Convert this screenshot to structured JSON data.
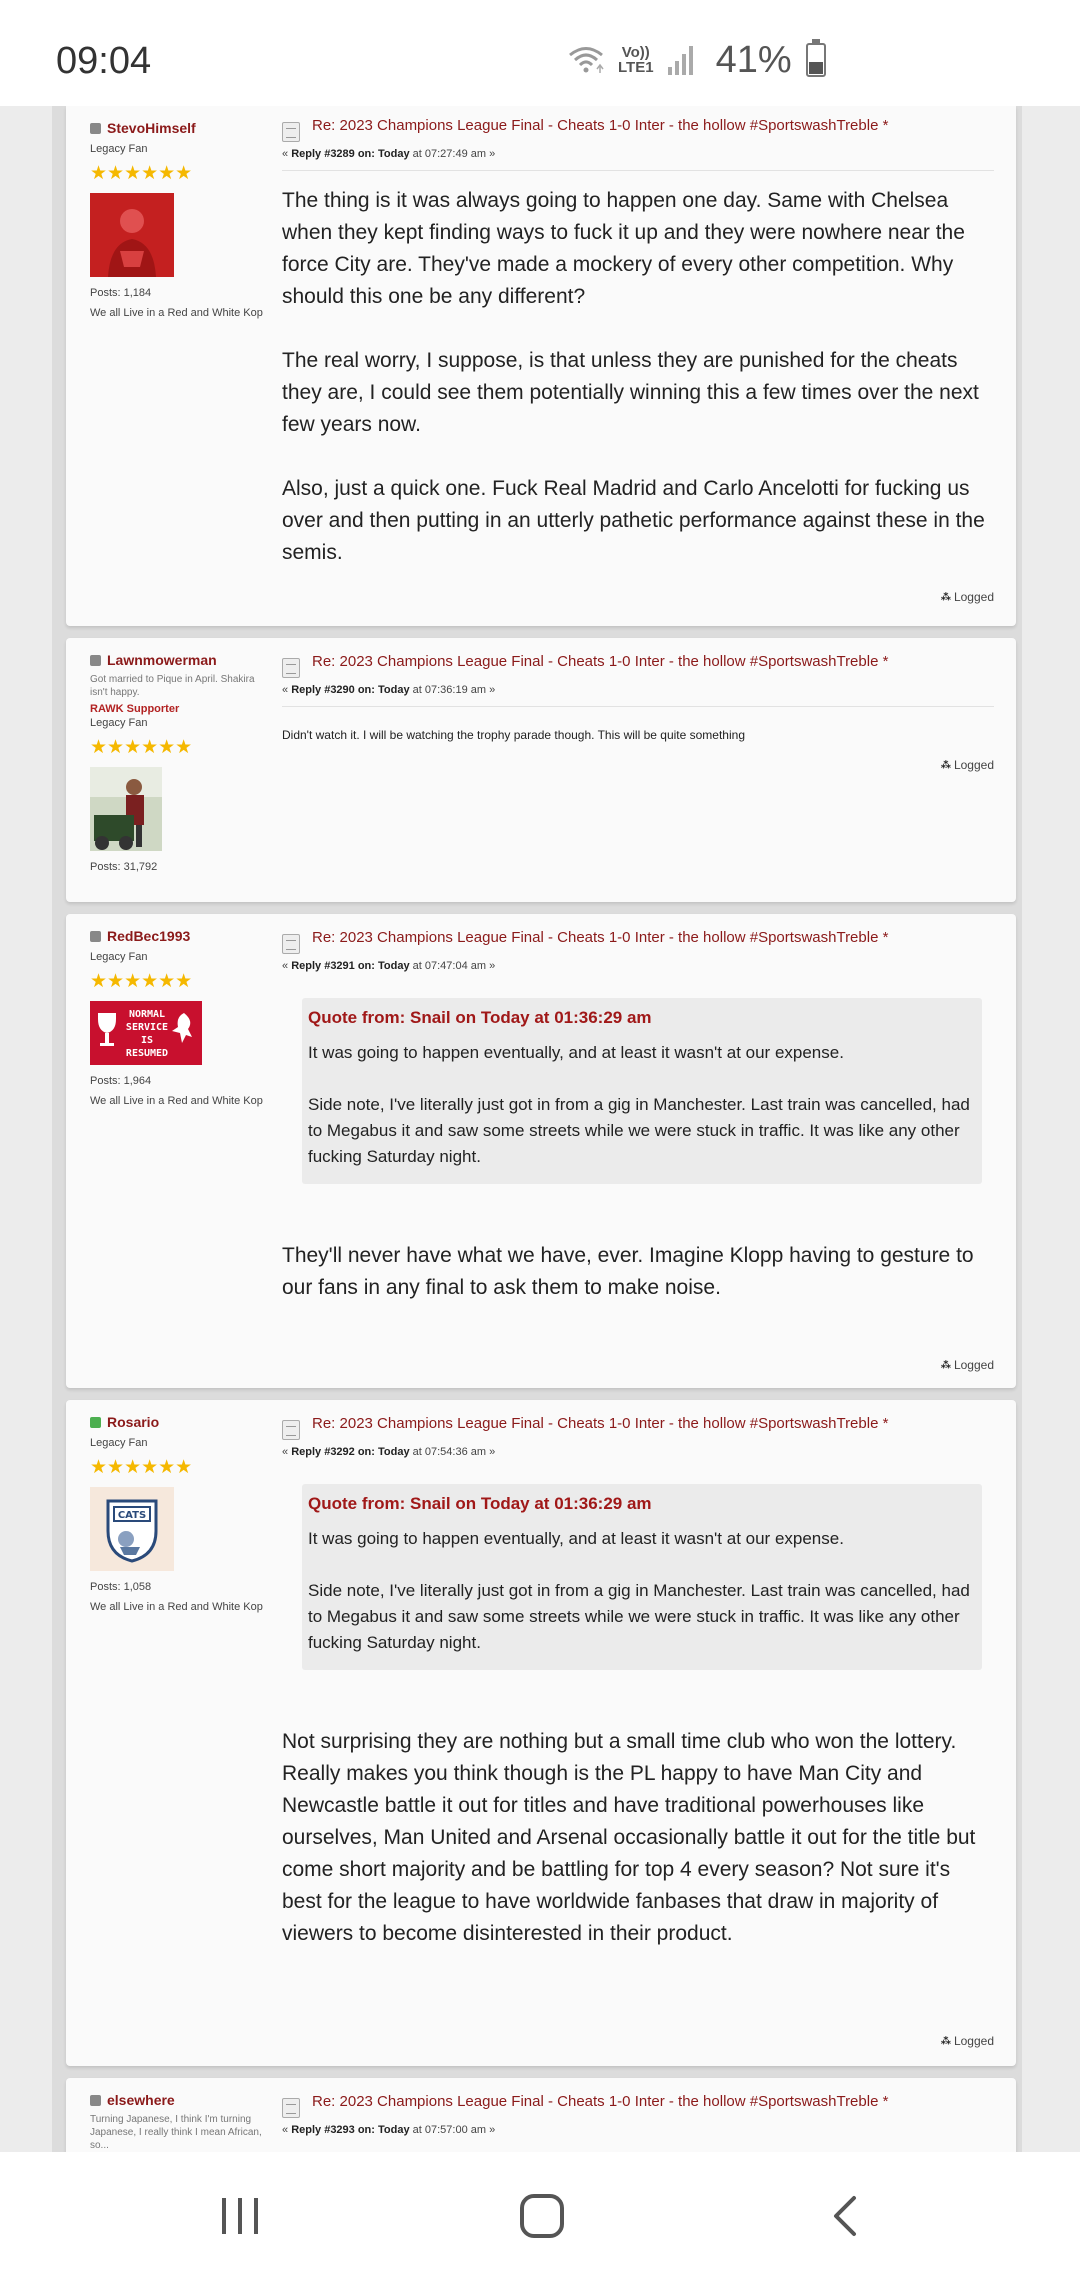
{
  "status_bar": {
    "time": "09:04",
    "volte": "Vo))",
    "lte": "LTE1",
    "battery": "41%",
    "battery_level": 0.41
  },
  "posts": [
    {
      "username": "StevoHimself",
      "online": false,
      "position": "Legacy Fan",
      "custom_title": "",
      "rawk_label": "",
      "stars": "★★★★★★",
      "posts": "Posts: 1,184",
      "personal_text": "We all Live in a Red and White Kop",
      "subject": "Re: 2023 Champions League Final - Cheats 1-0 Inter - the hollow #SportswashTreble *",
      "reply_prefix": "« ",
      "reply_label": "Reply #3289 on: Today",
      "reply_time": " at 07:27:49 am »",
      "paragraphs": [
        "The thing is it was always going to happen one day. Same with Chelsea when they kept finding ways to fuck it up and they were nowhere near the force City are. They've made a mockery of every other competition. Why should this one be any different?",
        "The real worry, I suppose, is that unless they are punished for the cheats they are, I could see them potentially winning this a few times over the next few years now.",
        "Also, just a quick one. Fuck Real Madrid and Carlo Ancelotti for fucking us over and then putting in an utterly pathetic performance against these in the semis."
      ],
      "logged": "Logged"
    },
    {
      "username": "Lawnmowerman",
      "online": false,
      "custom_title": "Got married to Pique in April. Shakira isn't happy.",
      "rawk_label": "RAWK Supporter",
      "position": "Legacy Fan",
      "stars": "★★★★★★",
      "posts": "Posts: 31,792",
      "personal_text": "",
      "subject": "Re: 2023 Champions League Final - Cheats 1-0 Inter - the hollow #SportswashTreble *",
      "reply_prefix": "« ",
      "reply_label": "Reply #3290 on: Today",
      "reply_time": " at 07:36:19 am »",
      "text": "Didn't watch it. I will be watching the trophy parade though. This will be quite something",
      "logged": "Logged"
    },
    {
      "username": "RedBec1993",
      "online": false,
      "position": "Legacy Fan",
      "stars": "★★★★★★",
      "avatar_text": [
        "NORMAL",
        "SERVICE",
        "IS",
        "RESUMED"
      ],
      "posts": "Posts: 1,964",
      "personal_text": "We all Live in a Red and White Kop",
      "subject": "Re: 2023 Champions League Final - Cheats 1-0 Inter - the hollow #SportswashTreble *",
      "reply_prefix": "« ",
      "reply_label": "Reply #3291 on: Today",
      "reply_time": " at 07:47:04 am »",
      "quote_head": "Quote from: Snail on Today at 01:36:29 am",
      "quote_paragraphs": [
        "It was going to happen eventually, and at least it wasn't at our expense.",
        "Side note, I've literally just got in from a gig in Manchester. Last train was cancelled, had to Megabus it and saw some streets while we were stuck in traffic. It was like any other fucking Saturday night."
      ],
      "text": "They'll never have what we have, ever. Imagine Klopp having to gesture to our fans in any final to ask them to make noise.",
      "logged": "Logged"
    },
    {
      "username": "Rosario",
      "online": true,
      "position": "Legacy Fan",
      "stars": "★★★★★★",
      "avatar_text": "CATS",
      "posts": "Posts: 1,058",
      "personal_text": "We all Live in a Red and White Kop",
      "subject": "Re: 2023 Champions League Final - Cheats 1-0 Inter - the hollow #SportswashTreble *",
      "reply_prefix": "« ",
      "reply_label": "Reply #3292 on: Today",
      "reply_time": " at 07:54:36 am »",
      "quote_head": "Quote from: Snail on Today at 01:36:29 am",
      "quote_paragraphs": [
        "It was going to happen eventually, and at least it wasn't at our expense.",
        "Side note, I've literally just got in from a gig in Manchester. Last train was cancelled, had to Megabus it and saw some streets while we were stuck in traffic. It was like any other fucking Saturday night."
      ],
      "text": "Not surprising they are nothing but a small time club who won the lottery. Really makes you think though is the PL happy to have Man City and Newcastle battle it out for titles and have traditional powerhouses like ourselves, Man United and Arsenal occasionally battle it out for the title but come short majority and be battling for top 4 every season? Not sure it's best for the league to have worldwide fanbases that draw in majority of viewers to become disinterested in their product.",
      "logged": "Logged"
    },
    {
      "username": "elsewhere",
      "online": false,
      "custom_title": "Turning Japanese, I think I'm turning Japanese, I really think I mean African, so...",
      "subject": "Re: 2023 Champions League Final - Cheats 1-0 Inter - the hollow #SportswashTreble *",
      "reply_prefix": "« ",
      "reply_label": "Reply #3293 on: Today",
      "reply_time": " at 07:57:00 am »"
    }
  ],
  "colors": {
    "accent": "#8b1a1a",
    "quote_head": "#a01818",
    "stars": "#f5b800",
    "online": "#4caf50"
  },
  "nav": {
    "recents_icon": "recent-apps-icon",
    "home_icon": "home-icon",
    "back_icon": "back-icon"
  }
}
